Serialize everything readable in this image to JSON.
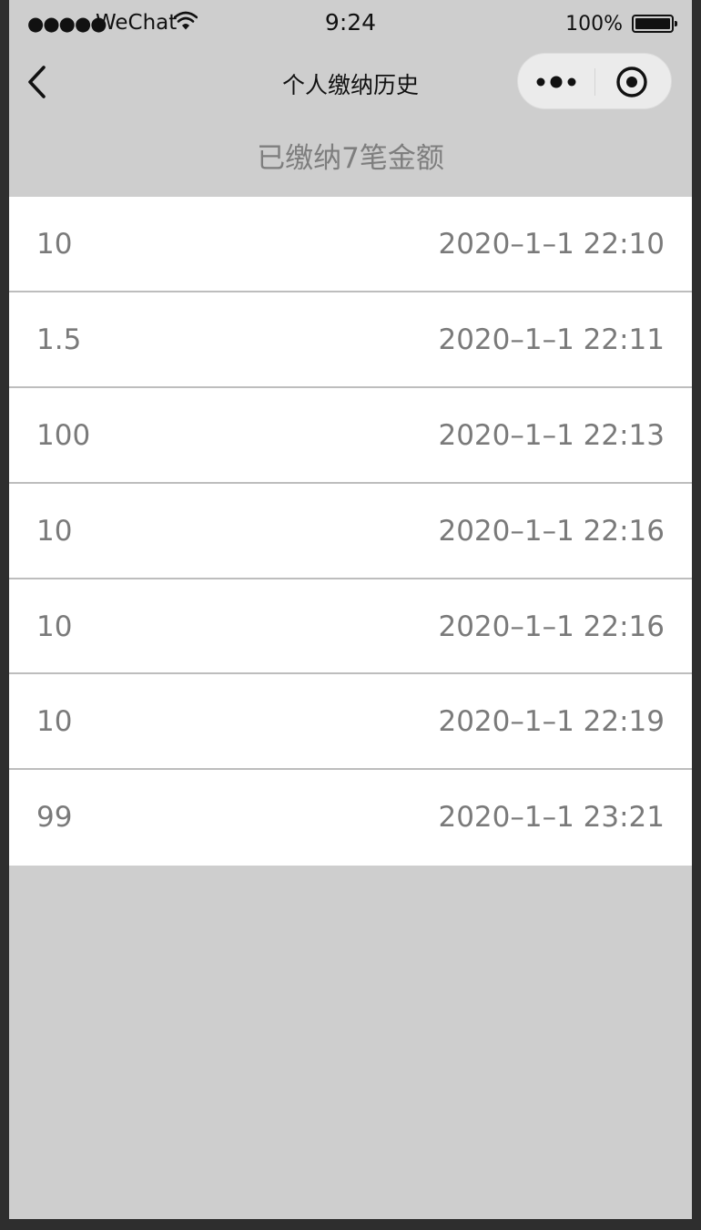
{
  "status_bar": {
    "signal": "●●●●●",
    "carrier": "WeChat",
    "time": "9:24",
    "battery": "100%"
  },
  "nav": {
    "title": "个人缴纳历史"
  },
  "summary": {
    "text": "已缴纳7笔金额"
  },
  "records": [
    {
      "amount": "10",
      "time": "2020–1–1 22:10"
    },
    {
      "amount": "1.5",
      "time": "2020–1–1 22:11"
    },
    {
      "amount": "100",
      "time": "2020–1–1 22:13"
    },
    {
      "amount": "10",
      "time": "2020–1–1 22:16"
    },
    {
      "amount": "10",
      "time": "2020–1–1 22:16"
    },
    {
      "amount": "10",
      "time": "2020–1–1 22:19"
    },
    {
      "amount": "99",
      "time": "2020–1–1 23:21"
    }
  ],
  "colors": {
    "page_background": "#cecece",
    "list_background": "#ffffff",
    "text_gray": "#7a7a7a",
    "divider": "#bdbdbd"
  },
  "icons": [
    "back-arrow-icon",
    "more-dots-icon",
    "close-target-icon",
    "wifi-icon",
    "battery-icon"
  ]
}
